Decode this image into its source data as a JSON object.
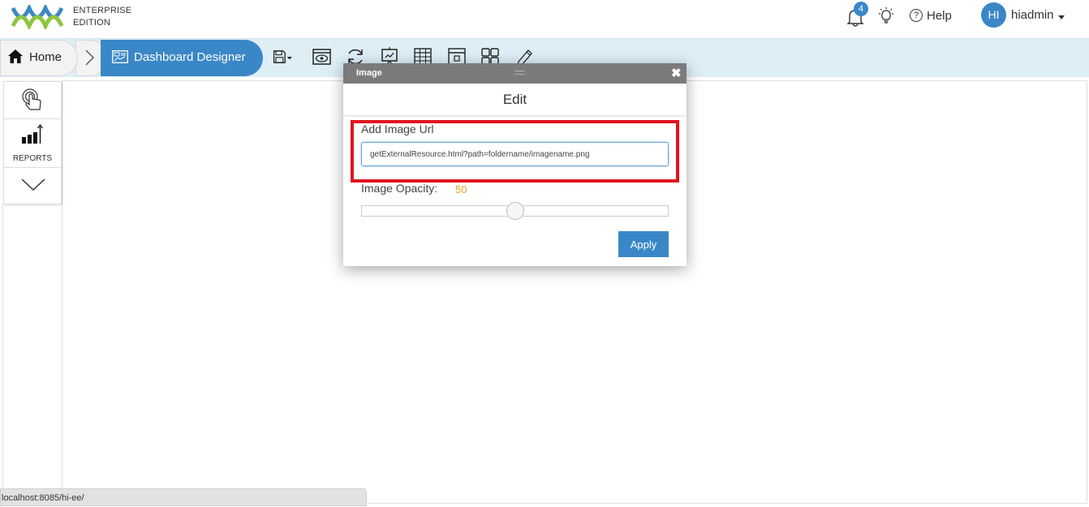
{
  "brand": {
    "line1": "ENTERPRISE",
    "line2": "EDITION",
    "logo_colors": [
      "#3a87c7",
      "#8dc63f"
    ]
  },
  "header": {
    "notification_count": "4",
    "help_label": "Help",
    "user_initials": "HI",
    "user_name": "hiadmin",
    "icons": [
      "bell-icon",
      "bulb-icon",
      "help-icon",
      "avatar",
      "chevron-down-icon"
    ]
  },
  "breadcrumb": {
    "home_label": "Home",
    "current_label": "Dashboard Designer"
  },
  "toolbar": {
    "icons": [
      "save-icon",
      "preview-icon",
      "refresh-icon",
      "presentation-icon",
      "table-icon",
      "window-icon",
      "grid-icon",
      "pen-icon"
    ]
  },
  "left_panel": {
    "reports_label": "REPORTS",
    "icons": [
      "touch-icon",
      "reports-chart-icon",
      "chevron-down-icon"
    ]
  },
  "dialog": {
    "title": "Image",
    "grip": "::::::::",
    "close_symbol": "✖",
    "subheading": "Edit",
    "url_label": "Add Image Url",
    "url_value": "getExternalResource.html?path=foldername/imagename.png",
    "opacity_label": "Image Opacity:",
    "opacity_value": "50",
    "opacity_fraction": 0.5,
    "apply_label": "Apply"
  },
  "statusbar": {
    "text": "localhost:8085/hi-ee/"
  },
  "colors": {
    "accent": "#3a87c7",
    "highlight": "#e0141e",
    "opacity_value": "#f0a020",
    "toolbar_bg": "#ddeef7"
  }
}
